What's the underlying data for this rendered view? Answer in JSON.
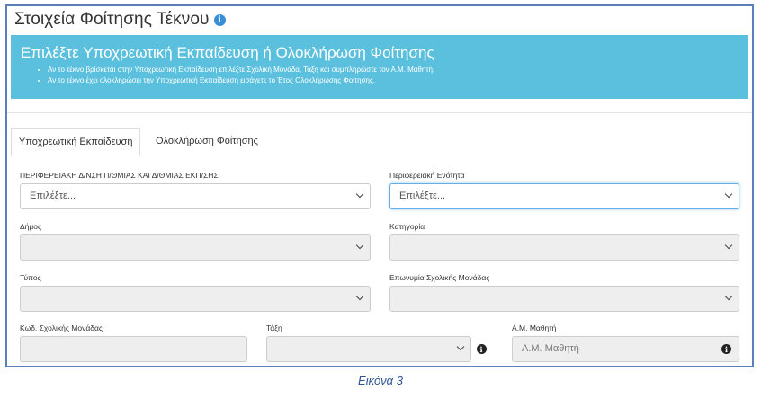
{
  "page_title": "Στοιχεία Φοίτησης Τέκνου",
  "alert": {
    "heading": "Επιλέξτε Υποχρεωτική Εκπαίδευση ή Ολοκλήρωση Φοίτησης",
    "bullets": [
      "Αν το τέκνο βρίσκεται στην Υποχρεωτική Εκπαίδευση επιλέξτε Σχολική Μονάδα, Τάξη και συμπληρώστε τον Α.Μ. Μαθητή.",
      "Αν το τέκνο έχει ολοκληρώσει την Υποχρεωτική Εκπαίδευση εισάγετε το Έτος Ολοκλήρωσης Φοίτησης."
    ],
    "color": "#5bc0de"
  },
  "tabs": [
    {
      "label": "Υποχρεωτική Εκπαίδευση",
      "active": true
    },
    {
      "label": "Ολοκλήρωση Φοίτησης",
      "active": false
    }
  ],
  "fields": {
    "perifereiaki": {
      "label": "ΠΕΡΙΦΕΡΕΙΑΚΗ Δ/ΝΣΗ Π/ΘΜΙΑΣ ΚΑΙ Δ/ΘΜΙΑΣ ΕΚΠ/ΣΗΣ",
      "value": "Επιλέξτε..."
    },
    "enotita": {
      "label": "Περιφερειακή Ενότητα",
      "value": "Επιλέξτε..."
    },
    "dimos": {
      "label": "Δήμος",
      "value": ""
    },
    "katigoria": {
      "label": "Κατηγορία",
      "value": ""
    },
    "typos": {
      "label": "Τύπος",
      "value": ""
    },
    "eponymia": {
      "label": "Επωνυμία Σχολικής Μονάδας",
      "value": ""
    },
    "kodikos": {
      "label": "Κωδ. Σχολικής Μονάδας",
      "value": ""
    },
    "taxi": {
      "label": "Τάξη",
      "value": ""
    },
    "am": {
      "label": "Α.Μ. Μαθητή",
      "placeholder": "Α.Μ. Μαθητή"
    }
  },
  "icons": {
    "title_info": "info-icon",
    "addon_info": "info-icon"
  },
  "caption": "Εικόνα 3",
  "accent_color": "#5b7fbd"
}
